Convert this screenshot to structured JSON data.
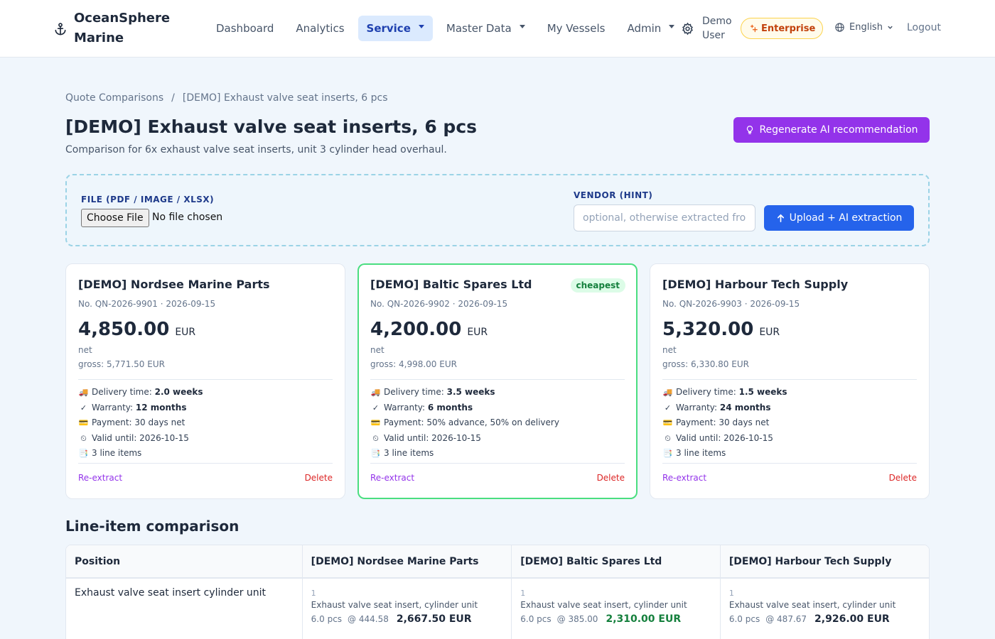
{
  "header": {
    "brand": "OceanSphere Marine",
    "nav": [
      {
        "label": "Dashboard",
        "dropdown": false,
        "active": false
      },
      {
        "label": "Analytics",
        "dropdown": false,
        "active": false
      },
      {
        "label": "Service",
        "dropdown": true,
        "active": true
      },
      {
        "label": "Master Data",
        "dropdown": true,
        "active": false
      },
      {
        "label": "My Vessels",
        "dropdown": false,
        "active": false
      },
      {
        "label": "Admin",
        "dropdown": true,
        "active": false
      }
    ],
    "user": "Demo User",
    "plan_badge": "Enterprise",
    "language": "English",
    "logout": "Logout"
  },
  "breadcrumb": {
    "parent": "Quote Comparisons",
    "separator": "/",
    "current": "[DEMO] Exhaust valve seat inserts, 6 pcs"
  },
  "page": {
    "title": "[DEMO] Exhaust valve seat inserts, 6 pcs",
    "subtitle": "Comparison for 6x exhaust valve seat inserts, unit 3 cylinder head overhaul.",
    "regen_button": "Regenerate AI recommendation"
  },
  "upload": {
    "file_label": "FILE (PDF / IMAGE / XLSX)",
    "choose_file": "Choose File",
    "no_file": "No file chosen",
    "vendor_label": "VENDOR (HINT)",
    "vendor_placeholder": "optional, otherwise extracted from file",
    "upload_button": "Upload + AI extraction"
  },
  "quotes": [
    {
      "vendor": "[DEMO] Nordsee Marine Parts",
      "meta": "No. QN-2026-9901 · 2026-09-15",
      "amount": "4,850.00",
      "currency": "EUR",
      "net": "net",
      "gross": "gross: 5,771.50 EUR",
      "badge": "",
      "delivery_label": "Delivery time:",
      "delivery": "2.0 weeks",
      "warranty_label": "Warranty:",
      "warranty": "12 months",
      "payment": "Payment: 30 days net",
      "valid": "Valid until: 2026-10-15",
      "items": "3 line items",
      "reextract": "Re-extract",
      "delete": "Delete"
    },
    {
      "vendor": "[DEMO] Baltic Spares Ltd",
      "meta": "No. QN-2026-9902 · 2026-09-15",
      "amount": "4,200.00",
      "currency": "EUR",
      "net": "net",
      "gross": "gross: 4,998.00 EUR",
      "badge": "cheapest",
      "delivery_label": "Delivery time:",
      "delivery": "3.5 weeks",
      "warranty_label": "Warranty:",
      "warranty": "6 months",
      "payment": "Payment: 50% advance, 50% on delivery",
      "valid": "Valid until: 2026-10-15",
      "items": "3 line items",
      "reextract": "Re-extract",
      "delete": "Delete"
    },
    {
      "vendor": "[DEMO] Harbour Tech Supply",
      "meta": "No. QN-2026-9903 · 2026-09-15",
      "amount": "5,320.00",
      "currency": "EUR",
      "net": "net",
      "gross": "gross: 6,330.80 EUR",
      "badge": "",
      "delivery_label": "Delivery time:",
      "delivery": "1.5 weeks",
      "warranty_label": "Warranty:",
      "warranty": "24 months",
      "payment": "Payment: 30 days net",
      "valid": "Valid until: 2026-10-15",
      "items": "3 line items",
      "reextract": "Re-extract",
      "delete": "Delete"
    }
  ],
  "comparison": {
    "title": "Line-item comparison",
    "headers": [
      "Position",
      "[DEMO] Nordsee Marine Parts",
      "[DEMO] Baltic Spares Ltd",
      "[DEMO] Harbour Tech Supply"
    ],
    "rows": [
      {
        "position": "Exhaust valve seat insert cylinder unit",
        "cells": [
          {
            "pos": "1",
            "desc": "Exhaust valve seat insert, cylinder unit",
            "qty": "6.0 pcs",
            "unit": "@ 444.58",
            "total": "2,667.50 EUR"
          },
          {
            "pos": "1",
            "desc": "Exhaust valve seat insert, cylinder unit",
            "qty": "6.0 pcs",
            "unit": "@ 385.00",
            "total": "2,310.00 EUR"
          },
          {
            "pos": "1",
            "desc": "Exhaust valve seat insert, cylinder unit",
            "qty": "6.0 pcs",
            "unit": "@ 487.67",
            "total": "2,926.00 EUR"
          }
        ]
      }
    ]
  },
  "colors": {
    "accent_purple": "#9333ea",
    "primary_blue": "#2563eb",
    "best_green": "#15803d",
    "delete_red": "#dc2626"
  }
}
